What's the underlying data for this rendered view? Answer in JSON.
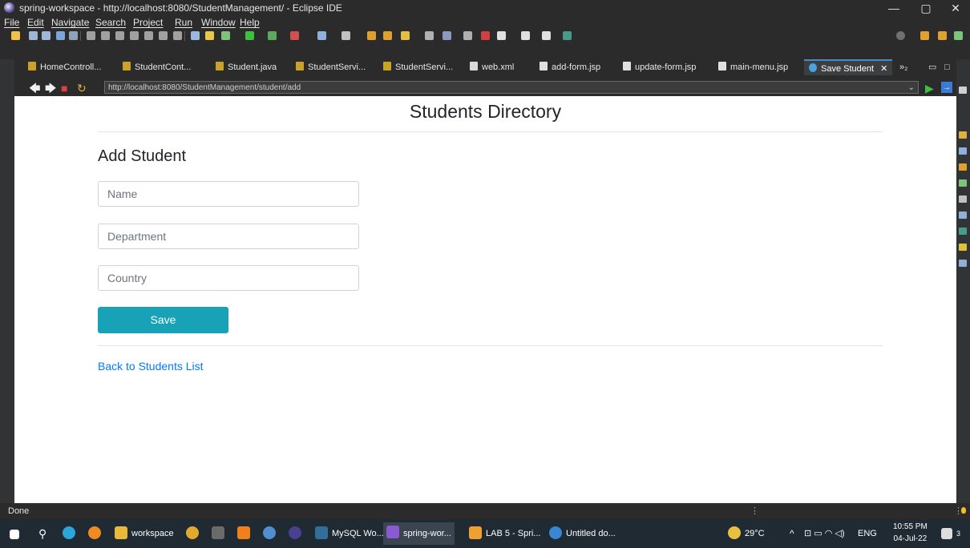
{
  "window": {
    "title": "spring-workspace - http://localhost:8080/StudentManagement/ - Eclipse IDE",
    "controls": {
      "minimize": "—",
      "maximize": "▢",
      "close": "✕"
    }
  },
  "menu": [
    "File",
    "Edit",
    "Navigate",
    "Search",
    "Project",
    "Run",
    "Window",
    "Help"
  ],
  "tabs": [
    {
      "label": "HomeControll...",
      "icon_color": "#c9a227"
    },
    {
      "label": "StudentCont...",
      "icon_color": "#c9a227"
    },
    {
      "label": "Student.java",
      "icon_color": "#c9a227"
    },
    {
      "label": "StudentServi...",
      "icon_color": "#c9a227"
    },
    {
      "label": "StudentServi...",
      "icon_color": "#c9a227"
    },
    {
      "label": "web.xml",
      "icon_color": "#d9d9d9"
    },
    {
      "label": "add-form.jsp",
      "icon_color": "#e0e0e0"
    },
    {
      "label": "update-form.jsp",
      "icon_color": "#e0e0e0"
    },
    {
      "label": "main-menu.jsp",
      "icon_color": "#e0e0e0"
    },
    {
      "label": "Save Student",
      "icon_color": "#4aa3df",
      "active": true
    }
  ],
  "tab_overflow": "»₂",
  "browser": {
    "url": "http://localhost:8080/StudentManagement/student/add"
  },
  "page": {
    "title": "Students Directory",
    "subtitle": "Add Student",
    "fields": [
      {
        "placeholder": "Name"
      },
      {
        "placeholder": "Department"
      },
      {
        "placeholder": "Country"
      }
    ],
    "save_label": "Save",
    "back_link": "Back to Students List"
  },
  "status": {
    "text": "Done"
  },
  "taskbar": {
    "apps": [
      {
        "label": "workspace"
      },
      {
        "label": "MySQL Wo..."
      },
      {
        "label": "spring-wor..."
      },
      {
        "label": "LAB 5 - Spri..."
      },
      {
        "label": "Untitled do..."
      }
    ],
    "weather": "29°C",
    "lang": "ENG",
    "time": "10:55 PM",
    "date": "04-Jul-22",
    "notifications": "3"
  },
  "colors": {
    "accent": "#17a2b8",
    "link": "#007bff",
    "ide_bg": "#2b2b2b",
    "taskbar_bg": "#1f2a33"
  }
}
